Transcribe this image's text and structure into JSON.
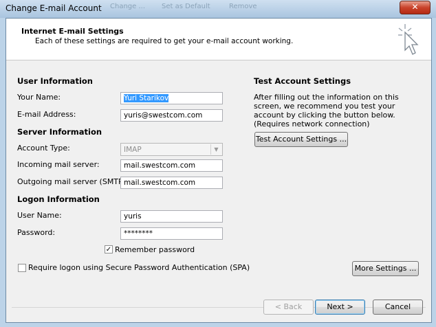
{
  "window": {
    "title": "Change E-mail Account",
    "close_label": "✕",
    "bg_tabs": [
      "Change ...",
      "Set as Default",
      "Remove"
    ]
  },
  "header": {
    "title": "Internet E-mail Settings",
    "subtitle": "Each of these settings are required to get your e-mail account working."
  },
  "user_info": {
    "heading": "User Information",
    "name_label": "Your Name:",
    "name_value": "Yuri Starikov",
    "email_label": "E-mail Address:",
    "email_value": "yuris@swestcom.com"
  },
  "server_info": {
    "heading": "Server Information",
    "account_type_label": "Account Type:",
    "account_type_value": "IMAP",
    "incoming_label": "Incoming mail server:",
    "incoming_value": "mail.swestcom.com",
    "outgoing_label": "Outgoing mail server (SMTP):",
    "outgoing_value": "mail.swestcom.com"
  },
  "logon_info": {
    "heading": "Logon Information",
    "user_label": "User Name:",
    "user_value": "yuris",
    "password_label": "Password:",
    "password_value": "********",
    "remember_label": "Remember password",
    "remember_checked": true,
    "spa_label": "Require logon using Secure Password Authentication (SPA)",
    "spa_checked": false
  },
  "test": {
    "heading": "Test Account Settings",
    "description": "After filling out the information on this screen, we recommend you test your account by clicking the button below. (Requires network connection)",
    "button": "Test Account Settings ..."
  },
  "buttons": {
    "more_settings": "More Settings ...",
    "back": "< Back",
    "next": "Next >",
    "cancel": "Cancel"
  },
  "colors": {
    "selection": "#3399ff",
    "dialog_bg": "#f0f0f0"
  }
}
